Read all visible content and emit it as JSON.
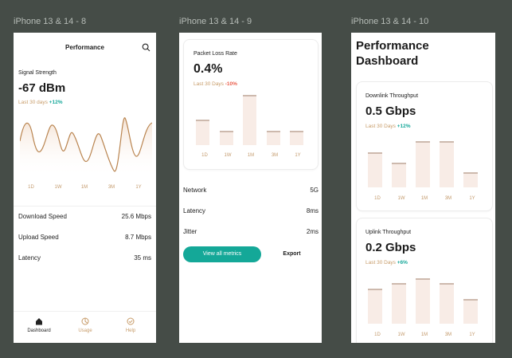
{
  "frames": [
    {
      "label": "iPhone 13 & 14 - 8"
    },
    {
      "label": "iPhone 13 & 14 - 9"
    },
    {
      "label": "iPhone 13 & 14 - 10"
    }
  ],
  "screen1": {
    "header_title": "Performance",
    "signal_label": "Signal Strength",
    "signal_value": "-67 dBm",
    "trend_prefix": "Last 30 days",
    "trend_change": "+12%",
    "ranges": [
      "1D",
      "1W",
      "1M",
      "3M",
      "1Y"
    ],
    "metrics": [
      {
        "label": "Download Speed",
        "value": "25.6 Mbps"
      },
      {
        "label": "Upload Speed",
        "value": "8.7 Mbps"
      },
      {
        "label": "Latency",
        "value": "35 ms"
      }
    ],
    "nav": [
      {
        "label": "Dashboard",
        "icon": "home-icon"
      },
      {
        "label": "Usage",
        "icon": "pie-chart-icon"
      },
      {
        "label": "Help",
        "icon": "check-circle-icon"
      }
    ]
  },
  "screen2": {
    "card_title": "Packet Loss Rate",
    "value": "0.4%",
    "trend_prefix": "Last 30 Days",
    "trend_change": "-10%",
    "ranges": [
      "1D",
      "1W",
      "1M",
      "3M",
      "1Y"
    ],
    "bar_values": [
      0.47,
      0.27,
      0.92,
      0.27,
      0.27
    ],
    "metrics": [
      {
        "label": "Network",
        "value": "5G"
      },
      {
        "label": "Latency",
        "value": "8ms"
      },
      {
        "label": "Jitter",
        "value": "2ms"
      }
    ],
    "primary_button": "View all metrics",
    "secondary_button": "Export"
  },
  "screen3": {
    "title_line1": "Performance",
    "title_line2": "Dashboard",
    "downlink": {
      "title": "Downlink Throughput",
      "value": "0.5 Gbps",
      "trend_prefix": "Last 30 Days",
      "trend_change": "+12%",
      "ranges": [
        "1D",
        "1W",
        "1M",
        "3M",
        "1Y"
      ],
      "bar_values": [
        0.73,
        0.52,
        0.97,
        0.97,
        0.31
      ]
    },
    "uplink": {
      "title": "Uplink Throughput",
      "value": "0.2 Gbps",
      "trend_prefix": "Last 30 Days",
      "trend_change": "+6%",
      "ranges": [
        "1D",
        "1W",
        "1M",
        "3M",
        "1Y"
      ],
      "bar_values": [
        0.74,
        0.85,
        0.95,
        0.85,
        0.52
      ]
    }
  },
  "colors": {
    "accent": "#c79b68",
    "positive": "#17a89a",
    "negative": "#ea5d4a",
    "primary_button": "#14a898",
    "bar_fill": "#f8ece6"
  }
}
